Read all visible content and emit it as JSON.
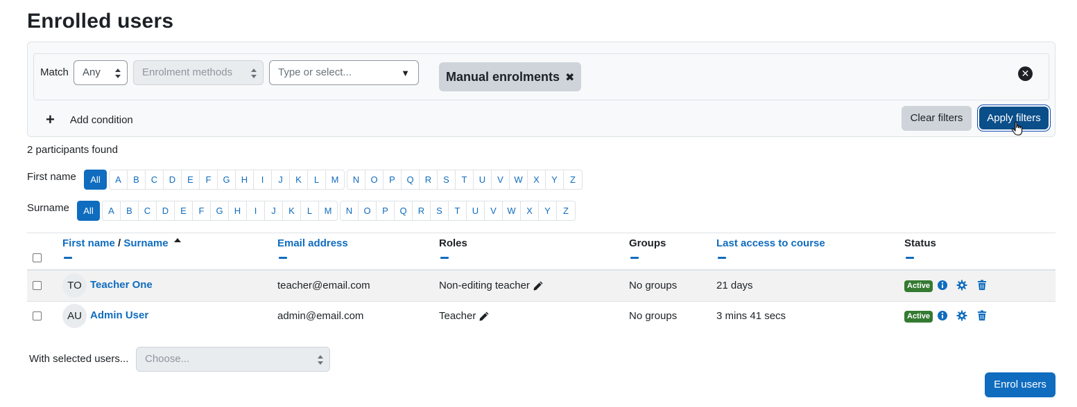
{
  "page": {
    "title": "Enrolled users"
  },
  "filters": {
    "match_label": "Match",
    "match_value": "Any",
    "type_value": "Enrolment methods",
    "value_placeholder": "Type or select...",
    "selected_chip": "Manual enrolments",
    "add_condition": "Add condition",
    "clear_button": "Clear filters",
    "apply_button": "Apply filters"
  },
  "participants_found": "2 participants found",
  "initials": {
    "first_name_label": "First name",
    "surname_label": "Surname",
    "all_label": "All",
    "group1": [
      "A",
      "B",
      "C",
      "D",
      "E",
      "F",
      "G",
      "H",
      "I",
      "J",
      "K",
      "L",
      "M"
    ],
    "group2": [
      "N",
      "O",
      "P",
      "Q",
      "R",
      "S",
      "T",
      "U",
      "V",
      "W",
      "X",
      "Y",
      "Z"
    ]
  },
  "table": {
    "headers": {
      "first_name": "First name",
      "separator": " / ",
      "surname": "Surname",
      "email": "Email address",
      "roles": "Roles",
      "groups": "Groups",
      "last_access": "Last access to course",
      "status": "Status"
    },
    "rows": [
      {
        "initials": "TO",
        "name": "Teacher One",
        "email": "teacher@email.com",
        "role": "Non-editing teacher",
        "groups": "No groups",
        "last_access": "21 days",
        "status": "Active"
      },
      {
        "initials": "AU",
        "name": "Admin User",
        "email": "admin@email.com",
        "role": "Teacher",
        "groups": "No groups",
        "last_access": "3 mins 41 secs",
        "status": "Active"
      }
    ]
  },
  "bulk": {
    "label": "With selected users...",
    "placeholder": "Choose..."
  },
  "enrol_button": "Enrol users",
  "colors": {
    "primary": "#0f6cbf",
    "active_badge": "#357a32",
    "secondary_btn": "#ced4da"
  }
}
